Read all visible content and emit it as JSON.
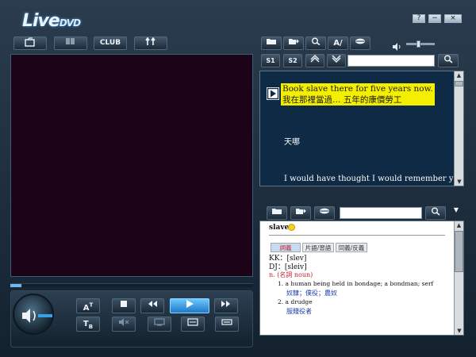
{
  "app": {
    "logo_main": "Live",
    "logo_sub": "DVD"
  },
  "window_controls": {
    "help": "?",
    "minimize": "−",
    "close": "×"
  },
  "toolbar": {
    "club_label": "CLUB"
  },
  "subtitles": {
    "english_line": "Book slave there for five years now.",
    "chinese_line": "我在那裡當過… 五年的康價勞工",
    "next_chinese": "天哪",
    "next_english": "I would have thought I would remember you.",
    "sub1_label": "S1",
    "sub2_label": "S2",
    "search_value": ""
  },
  "dictionary": {
    "search_value": "",
    "headword": "slave",
    "tabs": [
      "詞義",
      "片語/習語",
      "同義/反義"
    ],
    "kk_label": "KK：",
    "kk_pron": "[slev]",
    "dj_label": "DJ：",
    "dj_pron": "[sleiv]",
    "pos": "n. (名詞 noun)",
    "senses": [
      {
        "num": "1.",
        "en": "a human being held in bondage; a bondman; serf",
        "zh": "奴隸；僕役；農奴"
      },
      {
        "num": "2.",
        "en": "a drudge",
        "zh": "服賤役者"
      }
    ]
  },
  "colors": {
    "accent": "#3aa0e8",
    "subtitle_highlight": "#f4ef00",
    "video_bg": "#1b0417",
    "subtitle_bg": "#0e2a45",
    "dict_red": "#c1272d",
    "dict_blue": "#1b3fa8"
  }
}
